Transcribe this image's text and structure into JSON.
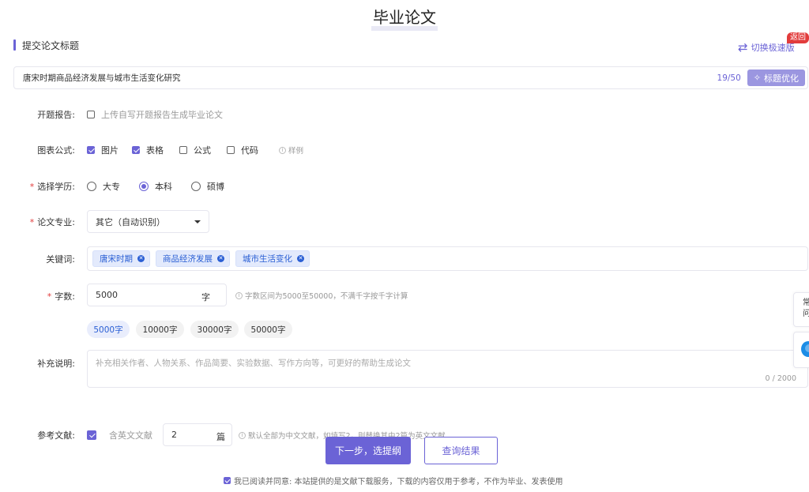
{
  "page": {
    "title": "毕业论文"
  },
  "section": {
    "title": "提交论文标题"
  },
  "top_right": {
    "switch_label": "切换极速版",
    "badge": "返回"
  },
  "title_field": {
    "value": "唐宋时期商品经济发展与城市生活变化研究",
    "count": "19/50",
    "optimize_label": "标题优化"
  },
  "opening_report": {
    "label": "开题报告:",
    "option": "上传自写开题报告生成毕业论文",
    "checked": false
  },
  "charts": {
    "label": "图表公式:",
    "options": [
      {
        "label": "图片",
        "checked": true
      },
      {
        "label": "表格",
        "checked": true
      },
      {
        "label": "公式",
        "checked": false
      },
      {
        "label": "代码",
        "checked": false
      }
    ],
    "example": "样例"
  },
  "degree": {
    "label": "选择学历:",
    "options": [
      {
        "label": "大专",
        "selected": false
      },
      {
        "label": "本科",
        "selected": true
      },
      {
        "label": "硕博",
        "selected": false
      }
    ]
  },
  "major": {
    "label": "论文专业:",
    "value": "其它（自动识别）"
  },
  "keywords": {
    "label": "关键词:",
    "tags": [
      "唐宋时期",
      "商品经济发展",
      "城市生活变化"
    ]
  },
  "word_count": {
    "label": "字数:",
    "value": "5000",
    "unit": "字",
    "hint": "字数区间为5000至50000，不满千字按千字计算",
    "presets": [
      {
        "label": "5000字",
        "selected": true
      },
      {
        "label": "10000字",
        "selected": false
      },
      {
        "label": "30000字",
        "selected": false
      },
      {
        "label": "50000字",
        "selected": false
      }
    ]
  },
  "supplement": {
    "label": "补充说明:",
    "placeholder": "补充相关作者、人物关系、作品简要、实验数据、写作方向等，可更好的帮助生成论文",
    "count": "0 / 2000"
  },
  "references": {
    "label": "参考文献:",
    "english_label": "含英文文献",
    "english_checked": true,
    "value": "2",
    "unit": "篇",
    "hint": "默认全部为中文文献，如填写2，则替换其中2篇为英文文献"
  },
  "actions": {
    "next": "下一步，选提纲",
    "query": "查询结果"
  },
  "agreement": {
    "text": "我已阅读并同意: 本站提供的是文献下载服务，下载的内容仅用于参考，不作为毕业、发表使用",
    "checked": true
  },
  "float_panel": {
    "text": "常问"
  },
  "colors": {
    "accent": "#6b63d6",
    "tag_text": "#2a5fd4",
    "required": "#e23c3c"
  }
}
